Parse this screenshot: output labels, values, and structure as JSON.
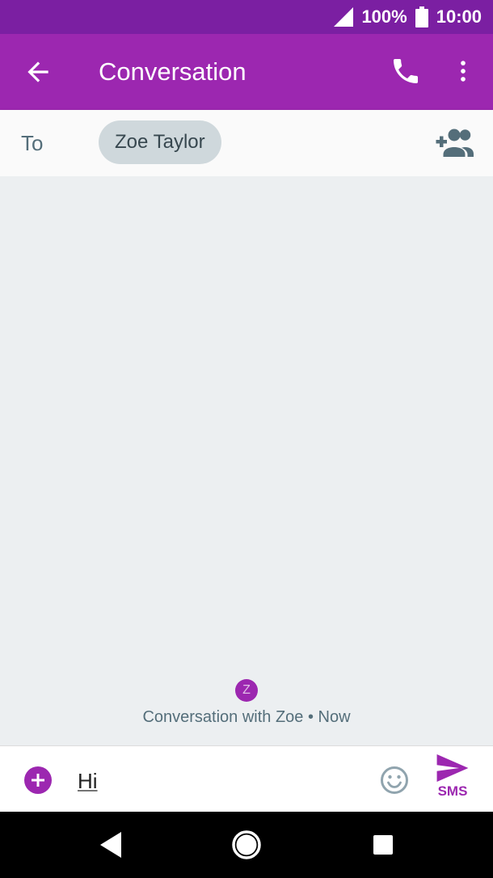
{
  "status_bar": {
    "battery": "100%",
    "time": "10:00"
  },
  "app_bar": {
    "title": "Conversation"
  },
  "to_bar": {
    "to_label": "To",
    "recipient": "Zoe Taylor"
  },
  "conversation": {
    "avatar_letter": "Z",
    "info": "Conversation with Zoe • Now"
  },
  "compose": {
    "text": "Hi",
    "send_label": "SMS"
  },
  "colors": {
    "primary": "#9c27b0",
    "primary_dark": "#7b1fa2",
    "chip": "#cfd8dc",
    "background": "#eceff1"
  },
  "icons": [
    "signal-icon",
    "battery-icon",
    "back-arrow-icon",
    "phone-icon",
    "more-vert-icon",
    "add-people-icon",
    "add-attachment-icon",
    "emoji-icon",
    "send-icon",
    "nav-back-icon",
    "nav-home-icon",
    "nav-recents-icon"
  ]
}
